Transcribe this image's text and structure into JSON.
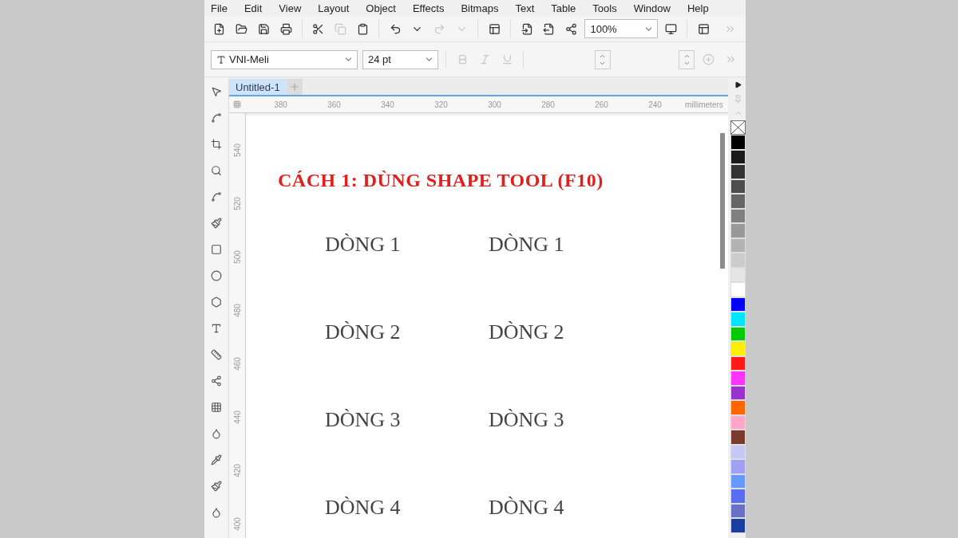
{
  "menu": [
    "File",
    "Edit",
    "View",
    "Layout",
    "Object",
    "Effects",
    "Bitmaps",
    "Text",
    "Table",
    "Tools",
    "Window",
    "Help"
  ],
  "standard_toolbar": {
    "zoom_field": {
      "value": "100%"
    }
  },
  "property_bar": {
    "font_field": {
      "value": "VNI-Meli"
    },
    "size_field": {
      "value": "24 pt"
    }
  },
  "document_tabs": [
    {
      "label": "Untitled-1",
      "selected": true
    }
  ],
  "horizontal_ruler": {
    "labels": [
      "380",
      "360",
      "340",
      "320",
      "300",
      "280",
      "260",
      "240"
    ],
    "unit": "millimeters"
  },
  "vertical_ruler": {
    "labels": [
      "540",
      "520",
      "500",
      "480",
      "460",
      "440",
      "420",
      "400"
    ]
  },
  "canvas": {
    "title": "CÁCH 1: DÙNG SHAPE TOOL (F10)",
    "rows": [
      {
        "left": "DÒNG 1",
        "right": "DÒNG 1"
      },
      {
        "left": "DÒNG 2",
        "right": "DÒNG 2"
      },
      {
        "left": "DÒNG 3",
        "right": "DÒNG 3"
      },
      {
        "left": "DÒNG 4",
        "right": "DÒNG 4"
      }
    ]
  },
  "palette": [
    {
      "color": "#000000"
    },
    {
      "color": "#1a1a1a"
    },
    {
      "color": "#333333"
    },
    {
      "color": "#4d4d4d"
    },
    {
      "color": "#666666"
    },
    {
      "color": "#808080"
    },
    {
      "color": "#999999"
    },
    {
      "color": "#b3b3b3"
    },
    {
      "color": "#cccccc"
    },
    {
      "color": "#e5e5e5"
    },
    {
      "color": "#ffffff"
    },
    {
      "color": "#0000ff"
    },
    {
      "color": "#00e5ff"
    },
    {
      "color": "#00cc00"
    },
    {
      "color": "#ffee00"
    },
    {
      "color": "#ff1a1a"
    },
    {
      "color": "#ff33ff"
    },
    {
      "color": "#9933cc"
    },
    {
      "color": "#ff6600"
    },
    {
      "color": "#ffa6c9"
    },
    {
      "color": "#7a3a30"
    },
    {
      "color": "#c8c8f5"
    },
    {
      "color": "#a0a0f5"
    },
    {
      "color": "#6699ff"
    },
    {
      "color": "#5c6cf0"
    },
    {
      "color": "#6870c8"
    },
    {
      "color": "#1a3fa0"
    }
  ]
}
